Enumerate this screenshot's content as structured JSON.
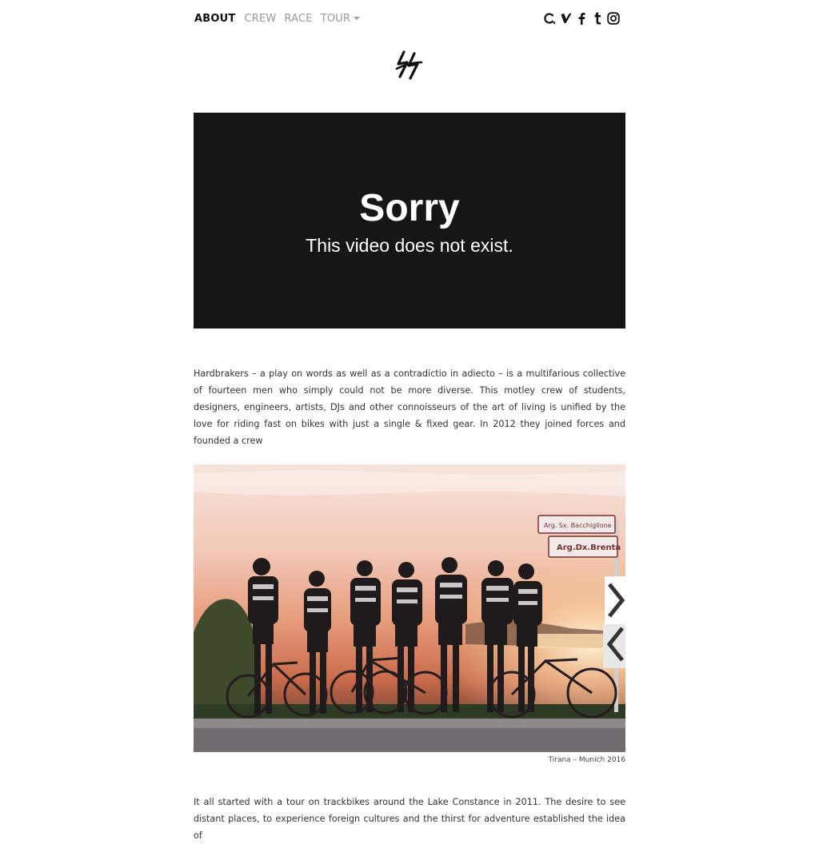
{
  "nav": {
    "items": [
      {
        "label": "ABOUT",
        "active": true
      },
      {
        "label": "CREW",
        "active": false
      },
      {
        "label": "RACE",
        "active": false
      },
      {
        "label": "TOUR",
        "active": false,
        "dropdown": true
      }
    ]
  },
  "social": {
    "icons": [
      "loading-icon",
      "vimeo-icon",
      "facebook-icon",
      "tumblr-icon",
      "instagram-icon"
    ]
  },
  "logo": {
    "icon": "hardbrakers-logo-icon"
  },
  "video": {
    "title": "Sorry",
    "message": "This video does not exist."
  },
  "intro": {
    "text": "Hardbrakers – a play on words as well as a contradictio in adiecto – is a multifarious collective of fourteen men who simply could not be more diverse. This motley crew of students, designers, engineers, artists, DJs and other connoisseurs of the art of living is unified by the love for riding fast on bikes with just a single & fixed gear. In 2012 they joined forces and founded a crew"
  },
  "photo": {
    "caption": "Tirana – Munich 2016",
    "signs": [
      "Arg. Sx. Bacchiglione",
      "Arg.Dx.Brenta"
    ]
  },
  "story": {
    "text": "It all started with a tour on trackbikes around the Lake Constance in 2011. The desire to see distant places, to experience foreign cultures and the thirst for adventure established the idea of"
  },
  "colors": {
    "background": "#ffffff",
    "video_bg": "#161616",
    "nav_active": "#111111",
    "nav_inactive": "#9a9a9a"
  }
}
